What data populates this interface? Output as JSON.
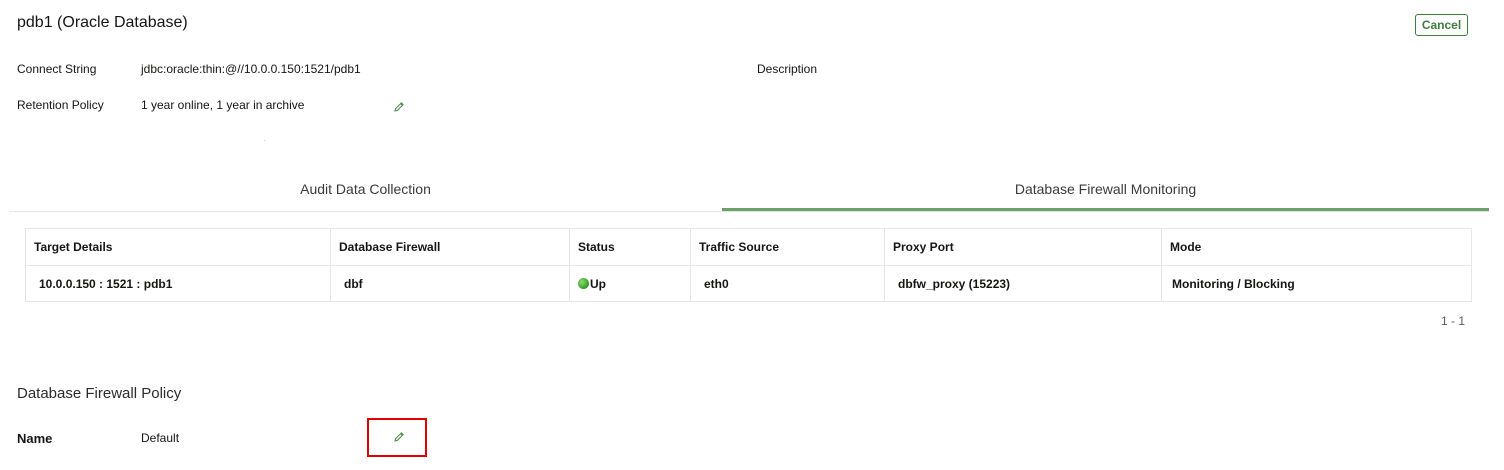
{
  "header": {
    "title": "pdb1 (Oracle Database)",
    "cancel_label": "Cancel"
  },
  "details": {
    "connect_string_label": "Connect String",
    "connect_string_value": "jdbc:oracle:thin:@//10.0.0.150:1521/pdb1",
    "description_label": "Description",
    "retention_label": "Retention Policy",
    "retention_value": "1 year online, 1 year in archive"
  },
  "tabs": [
    {
      "label": "Audit Data Collection",
      "selected": false
    },
    {
      "label": "Database Firewall Monitoring",
      "selected": true
    }
  ],
  "table": {
    "columns": [
      "Target Details",
      "Database Firewall",
      "Status",
      "Traffic Source",
      "Proxy Port",
      "Mode"
    ],
    "rows": [
      {
        "target_details": "10.0.0.150 : 1521 : pdb1",
        "database_firewall": "dbf",
        "status": "Up",
        "traffic_source": "eth0",
        "proxy_port": "dbfw_proxy (15223)",
        "mode": "Monitoring / Blocking"
      }
    ],
    "pagination": "1 - 1"
  },
  "policy": {
    "section_title": "Database Firewall Policy",
    "name_label": "Name",
    "name_value": "Default"
  },
  "icons": {
    "edit": "pencil-icon",
    "status": "green-circle-icon"
  },
  "colors": {
    "accent_green": "#3f7d3f",
    "tab_underline": "#6ca26a",
    "status_up": "#2e9a2a",
    "highlight_red": "#e00000"
  }
}
